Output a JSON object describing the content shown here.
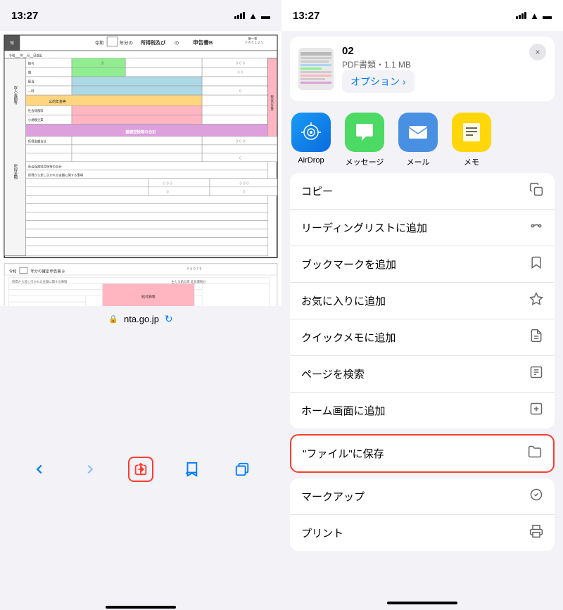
{
  "left": {
    "status_bar": {
      "time": "13:27"
    },
    "url_bar": {
      "lock_icon": "🔒",
      "url": "nta.go.jp",
      "reload_icon": "↻"
    },
    "toolbar": {
      "back_label": "‹",
      "forward_label": "›",
      "share_label": "⬆",
      "bookmarks_label": "📖",
      "tabs_label": "⧉"
    }
  },
  "right": {
    "status_bar": {
      "time": "13:27"
    },
    "file_preview": {
      "name": "02",
      "type": "PDF書類",
      "size": "1.1 MB",
      "options_label": "オプション ›",
      "close_label": "×"
    },
    "share_apps": [
      {
        "id": "airdrop",
        "label": "AirDrop",
        "icon": "📡"
      },
      {
        "id": "messages",
        "label": "メッセージ",
        "icon": "💬"
      },
      {
        "id": "mail",
        "label": "メール",
        "icon": "✉️"
      },
      {
        "id": "notes",
        "label": "メモ",
        "icon": "📝"
      }
    ],
    "actions": [
      {
        "id": "copy",
        "label": "コピー",
        "icon": "copy"
      },
      {
        "id": "reading-list",
        "label": "リーディングリストに追加",
        "icon": "reading"
      },
      {
        "id": "bookmark",
        "label": "ブックマークを追加",
        "icon": "bookmark"
      },
      {
        "id": "favorites",
        "label": "お気に入りに追加",
        "icon": "star"
      },
      {
        "id": "quick-note",
        "label": "クイックメモに追加",
        "icon": "quicknote"
      },
      {
        "id": "find",
        "label": "ページを検索",
        "icon": "find"
      },
      {
        "id": "home-screen",
        "label": "ホーム画面に追加",
        "icon": "home"
      },
      {
        "id": "save-files",
        "label": "\"ファイル\"に保存",
        "icon": "folder",
        "highlighted": true
      },
      {
        "id": "markup",
        "label": "マークアップ",
        "icon": "markup"
      },
      {
        "id": "print",
        "label": "プリント",
        "icon": "print"
      }
    ]
  }
}
